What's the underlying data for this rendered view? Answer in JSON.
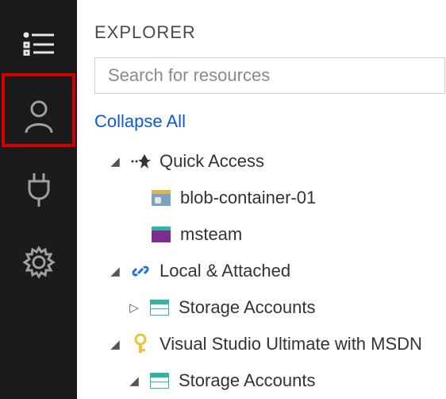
{
  "activity_bar": {
    "items": [
      {
        "name": "explorer-nav",
        "icon": "explorer"
      },
      {
        "name": "accounts-nav",
        "icon": "person"
      },
      {
        "name": "connect-nav",
        "icon": "plug"
      },
      {
        "name": "settings-nav",
        "icon": "gear"
      }
    ],
    "highlighted": "accounts-nav"
  },
  "explorer": {
    "title": "EXPLORER",
    "search_placeholder": "Search for resources",
    "collapse_label": "Collapse All"
  },
  "tree": {
    "nodes": [
      {
        "label": "Quick Access",
        "icon": "quick-access",
        "expanded": true,
        "children": [
          {
            "label": "blob-container-01",
            "icon": "blob-container"
          },
          {
            "label": "msteam",
            "icon": "table"
          }
        ]
      },
      {
        "label": "Local & Attached",
        "icon": "link",
        "expanded": true,
        "children": [
          {
            "label": "Storage Accounts",
            "icon": "storage",
            "expanded": false
          }
        ]
      },
      {
        "label": "Visual Studio Ultimate with MSDN",
        "icon": "key",
        "expanded": true,
        "children": [
          {
            "label": "Storage Accounts",
            "icon": "storage",
            "expanded": true
          }
        ]
      }
    ]
  },
  "colors": {
    "link": "#0b5bd2",
    "highlight": "#d40000",
    "sidebar_bg": "#1b1b1b"
  }
}
